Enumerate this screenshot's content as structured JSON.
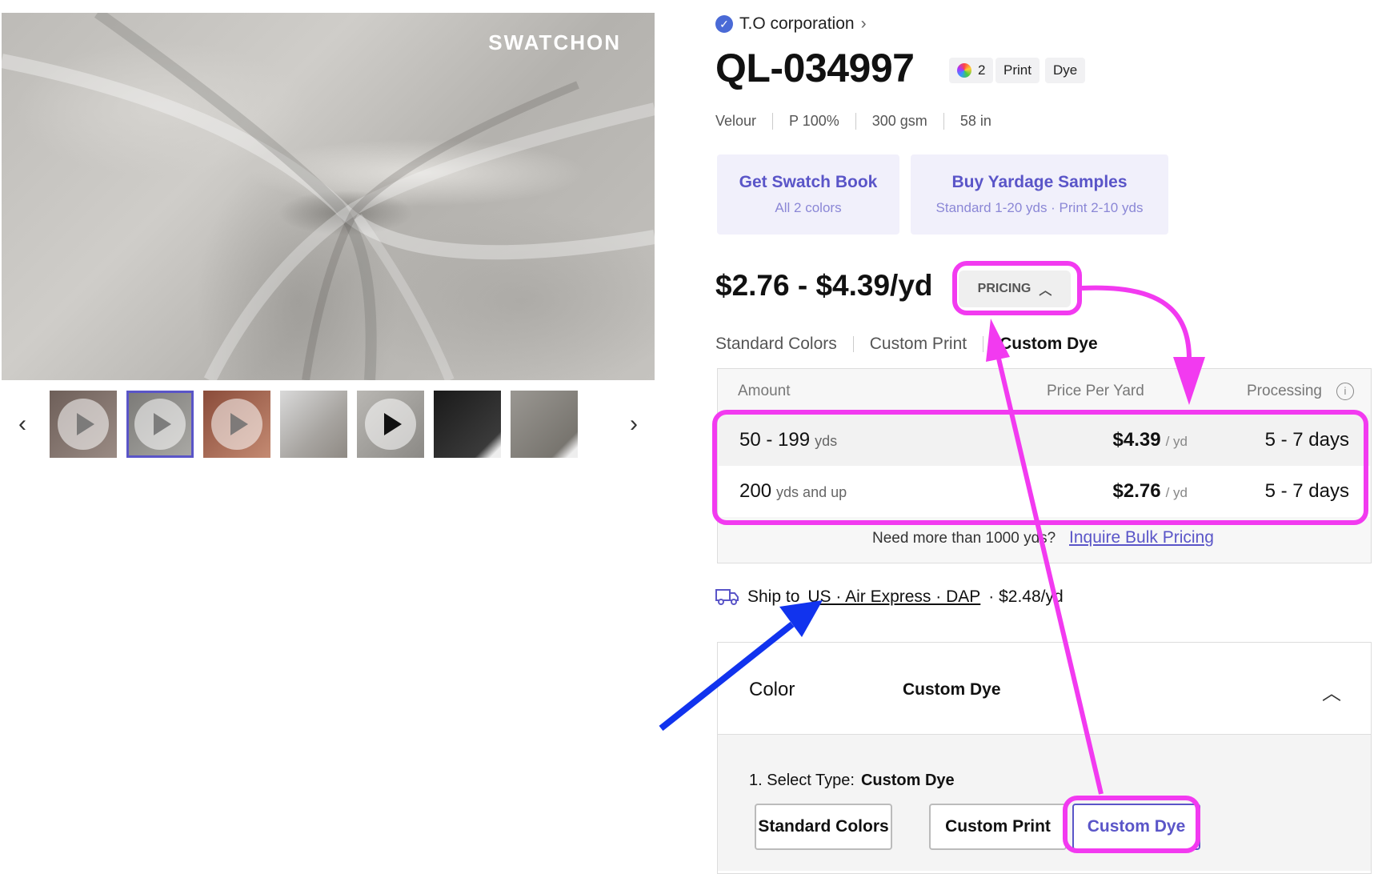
{
  "gallery": {
    "brand": "SWATCHON",
    "prev_icon": "chevron-left-icon",
    "next_icon": "chevron-right-icon",
    "thumbnails": [
      {
        "kind": "video"
      },
      {
        "kind": "video",
        "selected": true
      },
      {
        "kind": "video"
      },
      {
        "kind": "image"
      },
      {
        "kind": "video"
      },
      {
        "kind": "image"
      },
      {
        "kind": "image"
      }
    ]
  },
  "product": {
    "supplier": "T.O corporation",
    "code": "QL-034997",
    "color_count": "2",
    "tags": [
      "Print",
      "Dye"
    ],
    "specs": [
      "Velour",
      "P 100%",
      "300 gsm",
      "58 in"
    ]
  },
  "actions": {
    "swatch_title": "Get Swatch Book",
    "swatch_sub": "All 2 colors",
    "yardage_title": "Buy Yardage Samples",
    "yardage_sub": "Standard 1-20 yds · Print 2-10 yds"
  },
  "pricing": {
    "range": "$2.76 - $4.39/yd",
    "button": "PRICING",
    "tabs": [
      "Standard Colors",
      "Custom Print",
      "Custom Dye"
    ],
    "active_tab": "Custom Dye",
    "headers": {
      "amount": "Amount",
      "price": "Price Per Yard",
      "processing": "Processing"
    },
    "rows": [
      {
        "amount": "50 - 199",
        "unit": "yds",
        "price": "$4.39",
        "per": "/ yd",
        "processing": "5 - 7 days"
      },
      {
        "amount": "200",
        "unit": "yds and up",
        "price": "$2.76",
        "per": "/ yd",
        "processing": "5 - 7 days"
      }
    ],
    "bulk_text": "Need more than 1000 yds?",
    "bulk_link": "Inquire Bulk Pricing"
  },
  "shipping": {
    "prefix": "Ship to",
    "destination": "US · Air Express · DAP",
    "cost": "· $2.48/yd"
  },
  "color_section": {
    "label": "Color",
    "value": "Custom Dye",
    "select_label": "1. Select Type:",
    "select_value": "Custom Dye",
    "types": [
      "Standard Colors",
      "Custom Print",
      "Custom Dye"
    ]
  },
  "colors": {
    "accent": "#5a55c8",
    "highlight": "#f23af0",
    "arrow_blue": "#1133ee"
  }
}
